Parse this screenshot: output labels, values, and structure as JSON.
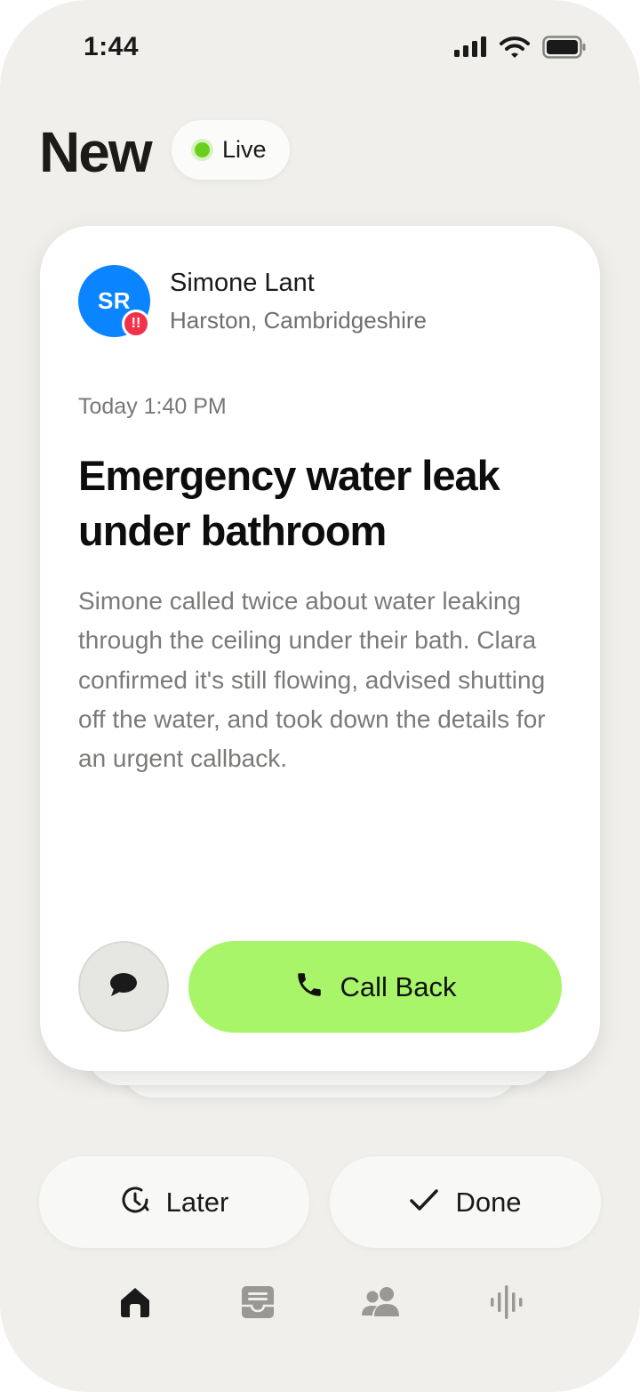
{
  "status_bar": {
    "time": "1:44"
  },
  "header": {
    "title": "New",
    "live_label": "Live"
  },
  "card": {
    "avatar_initials": "SR",
    "alert_badge": "!!",
    "caller_name": "Simone Lant",
    "caller_location": "Harston, Cambridgeshire",
    "timestamp": "Today 1:40 PM",
    "headline": "Emergency water leak under bathroom",
    "summary": "Simone called twice about water leaking through the ceiling under their bath. Clara confirmed it's still flowing, advised shutting off the water, and took down the details for an urgent callback.",
    "callback_label": "Call Back"
  },
  "actions": {
    "later_label": "Later",
    "done_label": "Done"
  },
  "icons": {
    "message": "chat-bubble-icon",
    "phone": "phone-icon",
    "later": "clock-icon",
    "done": "checkmark-icon",
    "tabs": [
      "home-icon",
      "inbox-icon",
      "contacts-icon",
      "voice-icon"
    ]
  },
  "colors": {
    "accent_green": "#a8f56a",
    "live_dot": "#6ccf1f",
    "avatar_blue": "#0a84ff",
    "alert_red": "#f0334a",
    "background": "#f0efeb"
  }
}
